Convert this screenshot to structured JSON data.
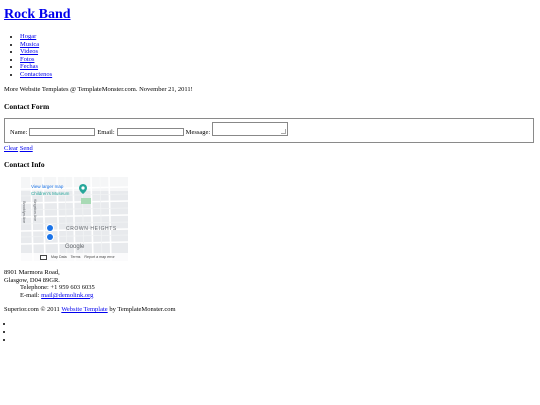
{
  "site": {
    "title": "Rock Band"
  },
  "nav": [
    "Hogar",
    "Musica",
    "Videos",
    "Fotos",
    "Fechas",
    "Contactenos"
  ],
  "tagline": "More Website Templates @ TemplateMonster.com. November 21, 2011!",
  "contact_form": {
    "heading": "Contact Form",
    "name_label": "Name:",
    "email_label": "Email:",
    "message_label": "Message:",
    "name_value": "",
    "email_value": "",
    "message_value": "",
    "clear_label": "Clear",
    "send_label": "Send"
  },
  "contact_info": {
    "heading": "Contact Info",
    "map": {
      "larger_map_link": "View larger map",
      "museum_label": "Children's Museum",
      "street_label_1": "Brooklyn Ave",
      "street_label_2": "Kingston Ave",
      "area_label": "CROWN HEIGHTS",
      "google_logo": "Google",
      "map_data": "Map Data",
      "terms": "Terms",
      "report": "Report a map error",
      "pin_color": "#1a73e8",
      "museum_pin_color": "#26a69a",
      "park_color": "#a8dab5"
    },
    "address_line1": "8901 Marmora Road,",
    "address_line2": "Glasgow, D04 89GR.",
    "telephone": "Telephone: +1 959 603 6035",
    "email_label": "E-mail:",
    "email": "mail@demolink.org"
  },
  "footer": {
    "prefix": "Superior.com © 2011",
    "link": "Website Template",
    "suffix": "by TemplateMonster.com"
  },
  "bottom_list_count": 3
}
